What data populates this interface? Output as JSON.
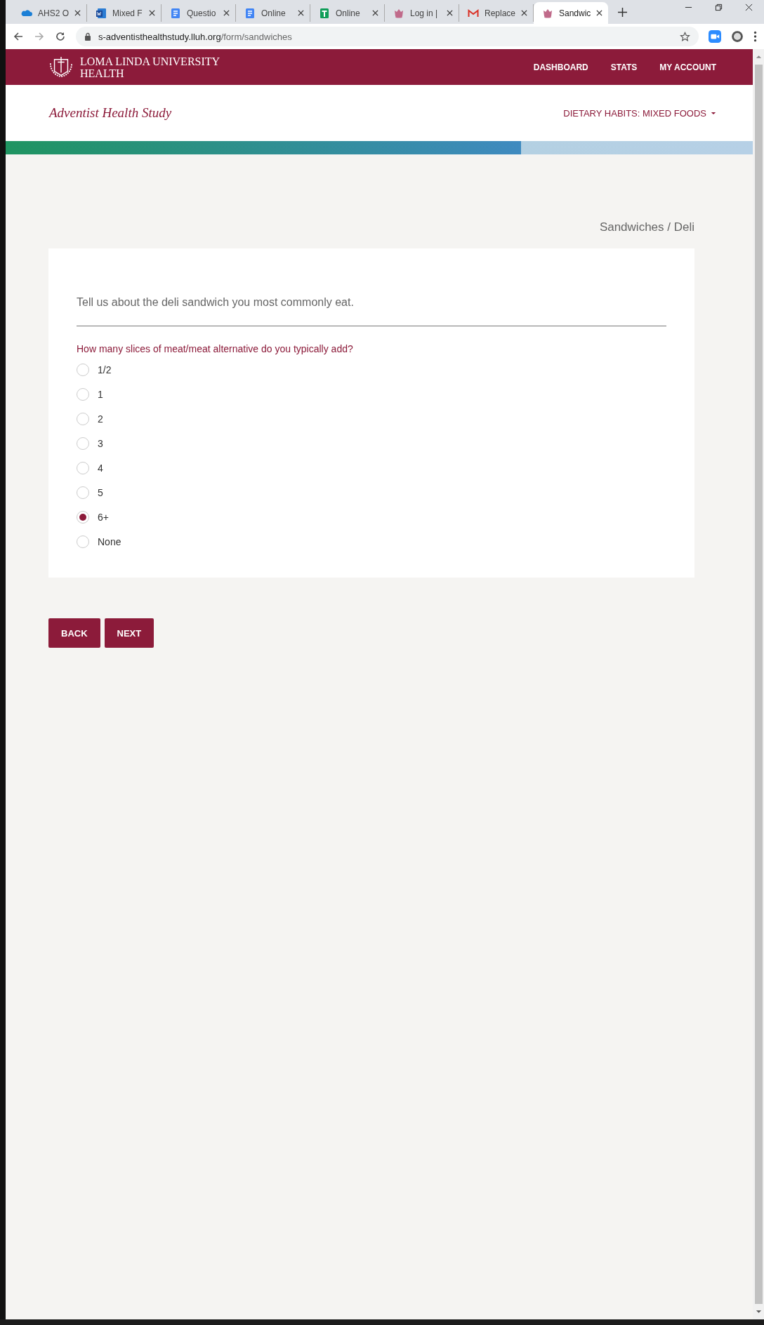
{
  "browser": {
    "tabs": [
      {
        "title": "AHS2 O",
        "kind": "cloud",
        "selected": false
      },
      {
        "title": "Mixed F",
        "kind": "word",
        "selected": false
      },
      {
        "title": "Questio",
        "kind": "doc",
        "selected": false
      },
      {
        "title": "Online",
        "kind": "doc",
        "selected": false
      },
      {
        "title": "Online",
        "kind": "sheet",
        "selected": false
      },
      {
        "title": "Log in |",
        "kind": "crest",
        "selected": false
      },
      {
        "title": "Replace",
        "kind": "mail",
        "selected": false
      },
      {
        "title": "Sandwic",
        "kind": "crest",
        "selected": true
      }
    ],
    "url_host": "s-adventisthealthstudy.lluh.org",
    "url_path": "/form/sandwiches"
  },
  "header": {
    "logo_line_1": "LOMA LINDA UNIVERSITY",
    "logo_line_2": "HEALTH",
    "nav": [
      "DASHBOARD",
      "STATS",
      "MY ACCOUNT"
    ]
  },
  "subheader": {
    "title": "Adventist Health Study",
    "section_menu": "DIETARY HABITS: MIXED FOODS"
  },
  "progress": {
    "level": 0.69
  },
  "breadcrumb": "Sandwiches / Deli",
  "form": {
    "intro": "Tell us about the deli sandwich you most commonly eat.",
    "question": "How many slices of meat/meat alternative do you typically add?",
    "options": [
      {
        "label": "1/2",
        "selected": false
      },
      {
        "label": "1",
        "selected": false
      },
      {
        "label": "2",
        "selected": false
      },
      {
        "label": "3",
        "selected": false
      },
      {
        "label": "4",
        "selected": false
      },
      {
        "label": "5",
        "selected": false
      },
      {
        "label": "6+",
        "selected": true
      },
      {
        "label": "None",
        "selected": false
      }
    ]
  },
  "buttons": [
    "BACK",
    "NEXT"
  ]
}
